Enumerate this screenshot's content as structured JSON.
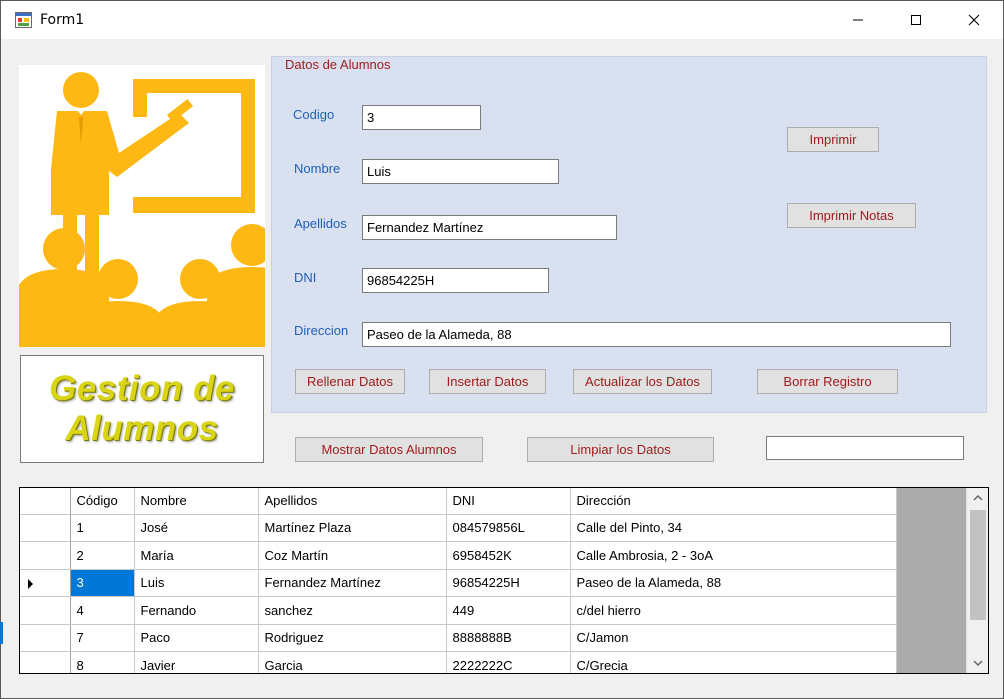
{
  "window": {
    "title": "Form1"
  },
  "banner": {
    "line1": "Gestion de",
    "line2": "Alumnos"
  },
  "groupbox": {
    "title": "Datos de Alumnos"
  },
  "form": {
    "codigo_label": "Codigo",
    "codigo_value": "3",
    "nombre_label": "Nombre",
    "nombre_value": "Luis",
    "apellidos_label": "Apellidos",
    "apellidos_value": "Fernandez Martínez",
    "dni_label": "DNI",
    "dni_value": "96854225H",
    "direccion_label": "Direccion",
    "direccion_value": "Paseo de la Alameda, 88"
  },
  "buttons": {
    "imprimir": "Imprimir",
    "imprimir_notas": "Imprimir Notas",
    "rellenar": "Rellenar Datos",
    "insertar": "Insertar Datos",
    "actualizar": "Actualizar los Datos",
    "borrar": "Borrar Registro",
    "mostrar": "Mostrar Datos Alumnos",
    "limpiar": "Limpiar los Datos"
  },
  "search": {
    "value": ""
  },
  "grid": {
    "columns": [
      "Código",
      "Nombre",
      "Apellidos",
      "DNI",
      "Dirección"
    ],
    "rows": [
      [
        "1",
        "José",
        "Martínez Plaza",
        "084579856L",
        "Calle del Pinto, 34"
      ],
      [
        "2",
        "María",
        "Coz Martín",
        "6958452K",
        "Calle Ambrosia, 2 - 3oA"
      ],
      [
        "3",
        "Luis",
        "Fernandez Martínez",
        "96854225H",
        "Paseo de la Alameda, 88"
      ],
      [
        "4",
        "Fernando",
        "sanchez",
        "449",
        "c/del hierro"
      ],
      [
        "7",
        "Paco",
        "Rodriguez",
        "8888888B",
        "C/Jamon"
      ],
      [
        "8",
        "Javier",
        "Garcia",
        "2222222C",
        "C/Grecia"
      ]
    ],
    "selected_row": 2
  },
  "icons": {
    "app": "app-form-icon",
    "minimize": "minimize-icon",
    "maximize": "maximize-icon",
    "close": "close-icon"
  },
  "colors": {
    "picture_figure": "#fdb813",
    "banner_text": "#d9d516",
    "label_blue": "#1f5fb8",
    "button_text": "#a01c1c",
    "groupbox_bg": "#d9e1f1",
    "selection": "#0078d7"
  }
}
